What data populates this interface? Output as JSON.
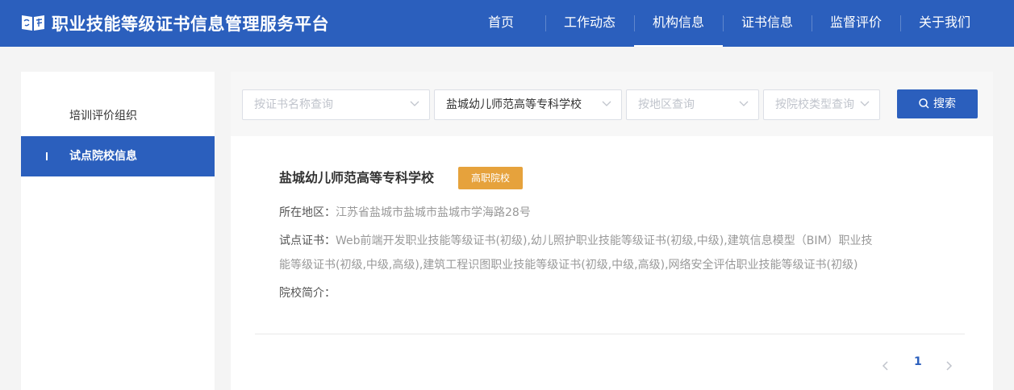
{
  "header": {
    "title": "职业技能等级证书信息管理服务平台",
    "nav": [
      "首页",
      "工作动态",
      "机构信息",
      "证书信息",
      "监督评价",
      "关于我们"
    ],
    "active_nav": "机构信息"
  },
  "sidebar": {
    "items": [
      {
        "label": "培训评价组织"
      },
      {
        "label": "试点院校信息"
      }
    ]
  },
  "filters": {
    "certificate": {
      "placeholder": "按证书名称查询"
    },
    "school": {
      "value": "盐城幼儿师范高等专科学校"
    },
    "region": {
      "placeholder": "按地区查询"
    },
    "school_type": {
      "placeholder": "按院校类型查询"
    },
    "search_label": "搜索"
  },
  "result": {
    "name": "盐城幼儿师范高等专科学校",
    "badge": "高职院校",
    "region_label": "所在地区：",
    "region_value": "江苏省盐城市盐城市盐城市学海路28号",
    "certs_label": "试点证书：",
    "certs_value": "Web前端开发职业技能等级证书(初级),幼儿照护职业技能等级证书(初级,中级),建筑信息模型（BIM）职业技能等级证书(初级,中级,高级),建筑工程识图职业技能等级证书(初级,中级,高级),网络安全评估职业技能等级证书(初级)",
    "intro_label": "院校简介："
  },
  "pagination": {
    "current": "1"
  },
  "colors": {
    "primary": "#2b5fbd",
    "badge": "#e6a23c",
    "page_bg": "#f4f4f4"
  }
}
